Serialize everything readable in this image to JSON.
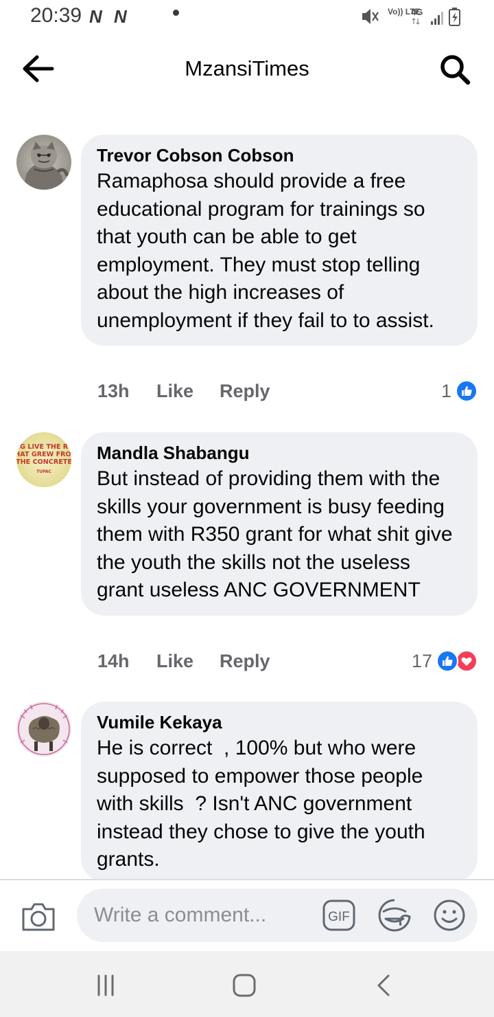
{
  "status_bar": {
    "time": "20:39",
    "notif_icons": [
      "N",
      "N"
    ],
    "network_volte": "Vo)) LTE",
    "network_type": "4G"
  },
  "header": {
    "title": "MzansiTimes"
  },
  "comments": [
    {
      "author": "Trevor Cobson Cobson",
      "text": "Ramaphosa should provide a free educational program for trainings so that youth can be able to get employment. They must stop telling about the high increases of unemployment if they fail to to assist.",
      "time": "13h",
      "like_label": "Like",
      "reply_label": "Reply",
      "reaction_count": "1",
      "reactions": [
        "like"
      ],
      "avatar": "cat-photo"
    },
    {
      "author": "Mandla Shabangu",
      "text": "But instead of providing them with the skills your government is busy feeding them with R350 grant for what shit give the youth the skills not the useless grant useless ANC GOVERNMENT",
      "time": "14h",
      "like_label": "Like",
      "reply_label": "Reply",
      "reaction_count": "17",
      "reactions": [
        "like",
        "love"
      ],
      "avatar": "quote-badge"
    },
    {
      "author": "Vumile Kekaya",
      "text": "He is correct  , 100% but who were supposed to empower those people with skills  ? Isn't ANC government instead they chose to give the youth grants.",
      "avatar": "sheep-photo"
    }
  ],
  "avatar_text": {
    "line1": "LONG LIVE THE ROSE",
    "line2": "THAT GREW FROM",
    "line3": "THE CONCRETE",
    "line4": "TUPAC"
  },
  "composer": {
    "placeholder": "Write a comment...",
    "gif_label": "GIF"
  },
  "colors": {
    "bubble": "#eff0f4",
    "secondary_text": "#65676b",
    "like_blue": "#1877f2",
    "love_red": "#f33e58"
  }
}
